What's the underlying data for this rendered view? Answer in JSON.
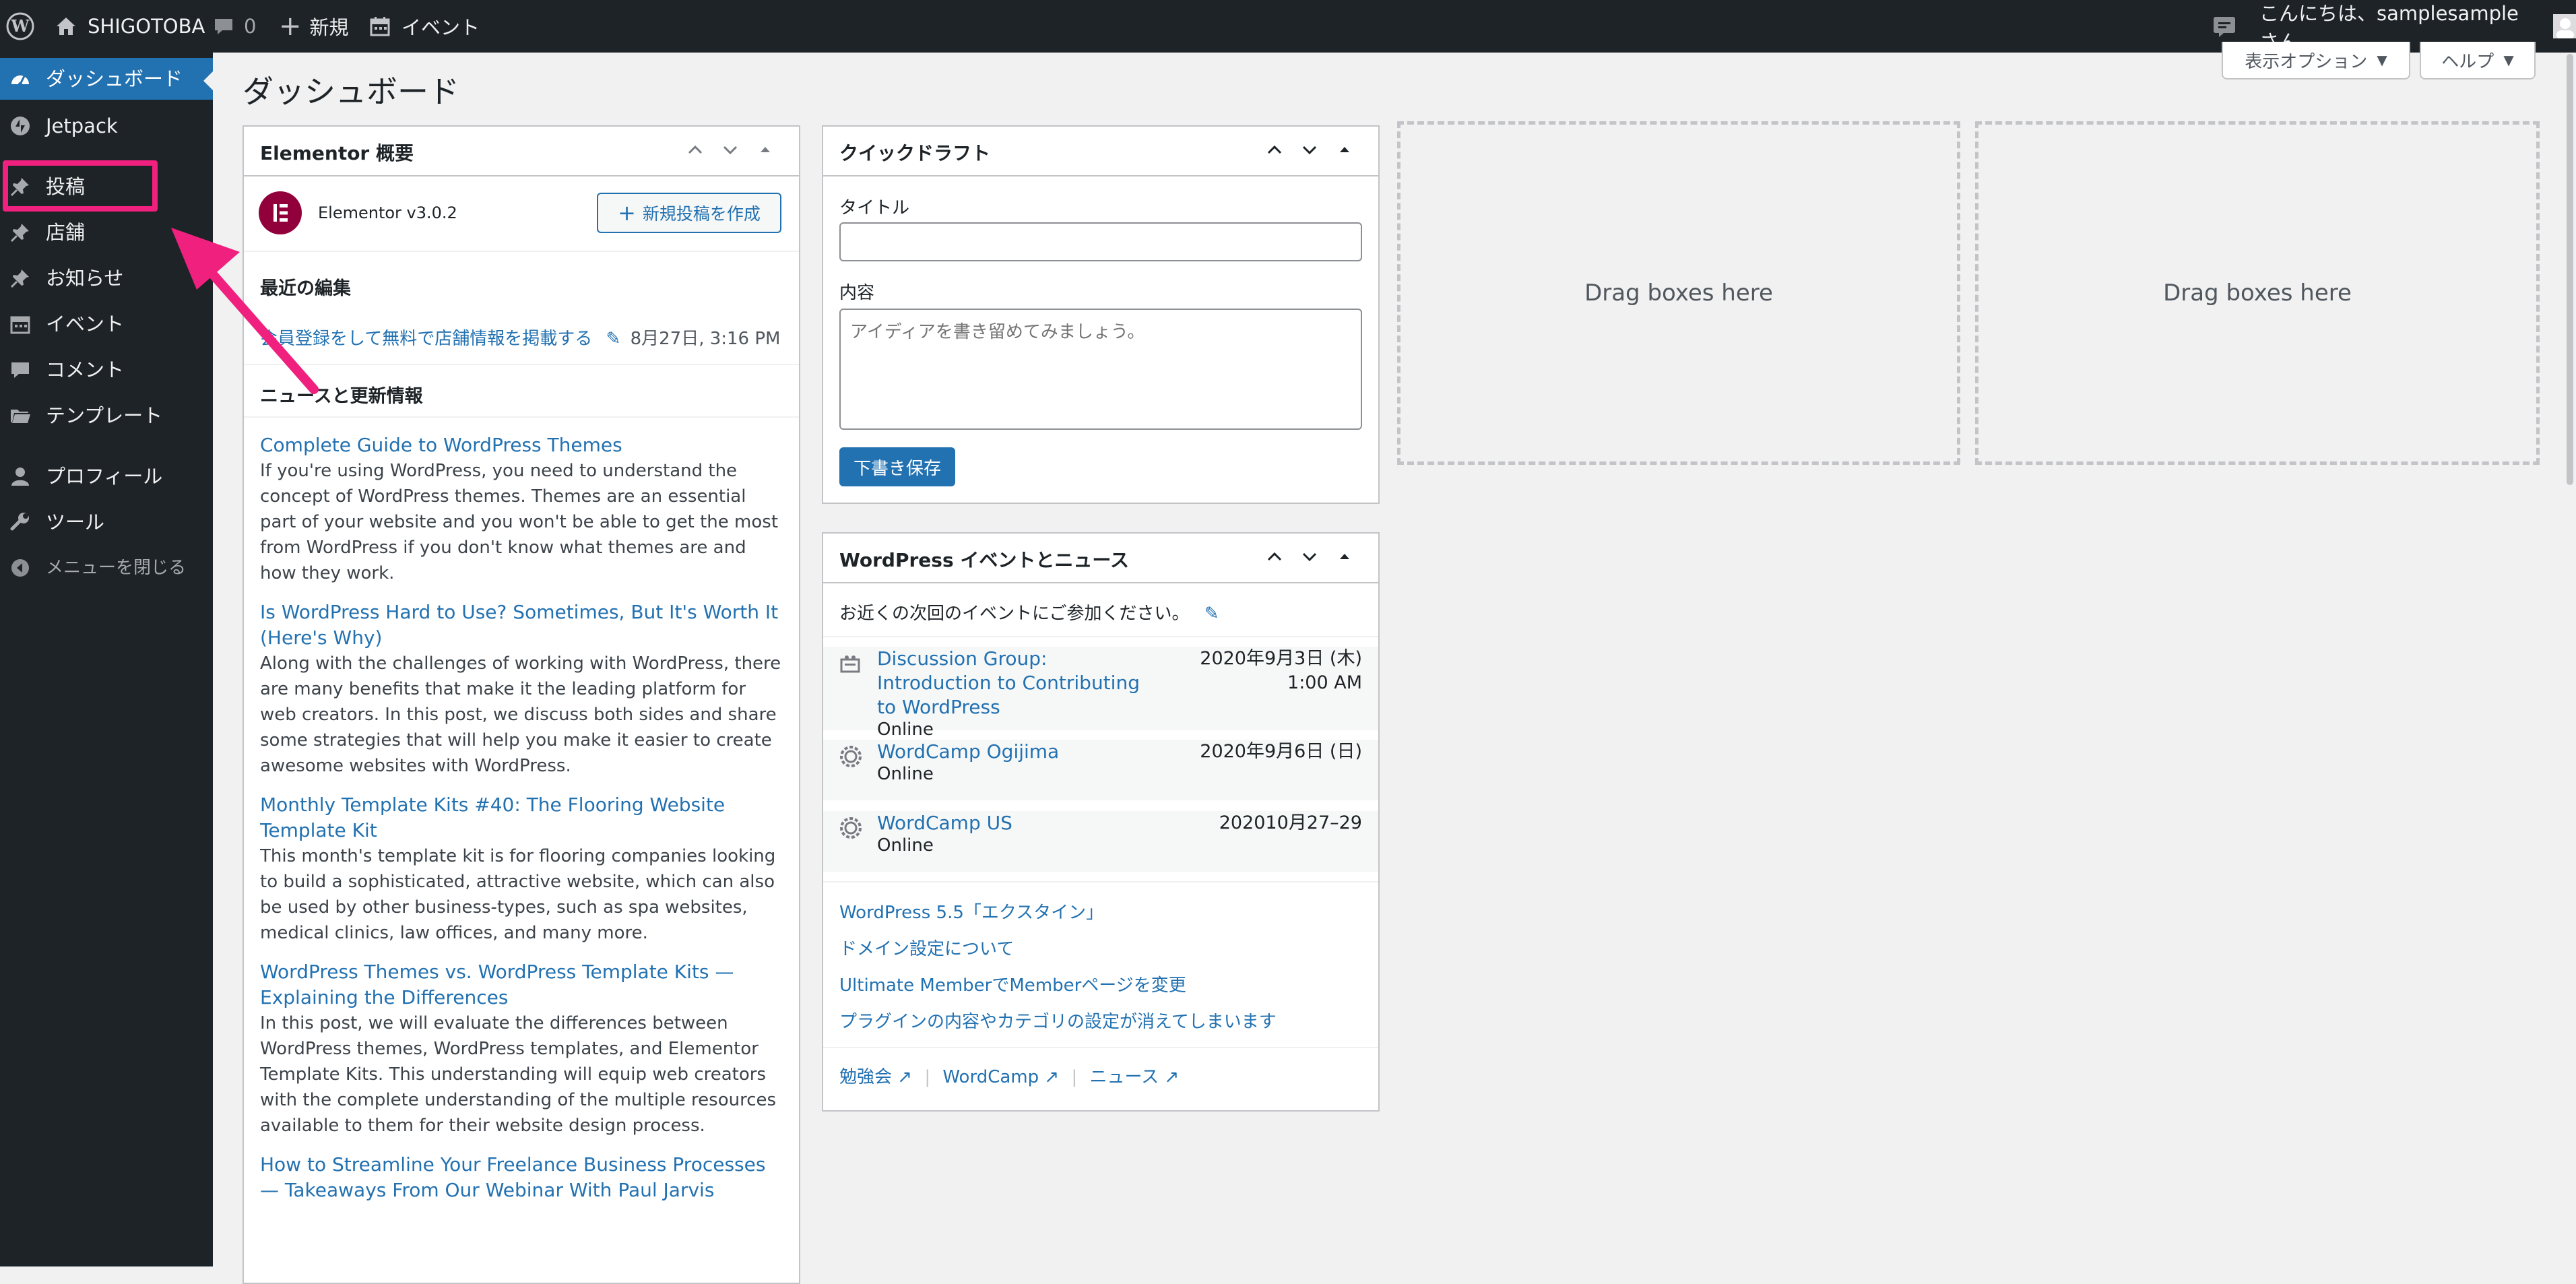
{
  "adminbar": {
    "site_name": "SHIGOTOBA",
    "comments_count": "0",
    "new_label": "新規",
    "event_label": "イベント",
    "greeting": "こんにちは、samplesample さん"
  },
  "sidebar": {
    "items": [
      {
        "label": "ダッシュボード",
        "icon": "dashboard-icon"
      },
      {
        "label": "Jetpack",
        "icon": "jetpack-icon"
      },
      {
        "label": "投稿",
        "icon": "pin-icon"
      },
      {
        "label": "店舗",
        "icon": "pin-icon"
      },
      {
        "label": "お知らせ",
        "icon": "pin-icon"
      },
      {
        "label": "イベント",
        "icon": "calendar-icon"
      },
      {
        "label": "コメント",
        "icon": "comment-icon"
      },
      {
        "label": "テンプレート",
        "icon": "folder-icon"
      },
      {
        "label": "プロフィール",
        "icon": "user-icon"
      },
      {
        "label": "ツール",
        "icon": "wrench-icon"
      },
      {
        "label": "メニューを閉じる",
        "icon": "collapse-icon"
      }
    ]
  },
  "header": {
    "title": "ダッシュボード",
    "screen_options": "表示オプション",
    "help": "ヘルプ"
  },
  "elementor": {
    "title": "Elementor 概要",
    "version": "Elementor v3.0.2",
    "create_button": "新規投稿を作成",
    "recent_heading": "最近の編集",
    "recent_item": "会員登録をして無料で店舗情報を掲載する",
    "recent_date": "8月27日, 3:16 PM",
    "news_heading": "ニュースと更新情報",
    "news": [
      {
        "title": "Complete Guide to WordPress Themes",
        "excerpt": "If you're using WordPress, you need to understand the concept of WordPress themes. Themes are an essential part of your website and you won't be able to get the most from WordPress if you don't know what themes are and how they work."
      },
      {
        "title": "Is WordPress Hard to Use? Sometimes, But It's Worth It (Here's Why)",
        "excerpt": "Along with the challenges of working with WordPress, there are many benefits that make it the leading platform for web creators. In this post, we discuss both sides and share some strategies that will help you make it easier to create awesome websites with WordPress."
      },
      {
        "title": "Monthly Template Kits #40: The Flooring Website Template Kit",
        "excerpt": "This month's template kit is for flooring companies looking to build a sophisticated, attractive website, which can also be used by other business-types, such as spa websites, medical clinics, law offices, and many more."
      },
      {
        "title": "WordPress Themes vs. WordPress Template Kits — Explaining the Differences",
        "excerpt": "In this post, we will evaluate the differences between WordPress themes, WordPress templates, and Elementor Template Kits. This understanding will equip web creators with the complete understanding of the multiple resources available to them for their website design process."
      },
      {
        "title": "How to Streamline Your Freelance Business Processes — Takeaways From Our Webinar With Paul Jarvis",
        "excerpt": ""
      }
    ]
  },
  "quickdraft": {
    "title": "クイックドラフト",
    "title_label": "タイトル",
    "title_value": "",
    "content_label": "内容",
    "content_placeholder": "アイディアを書き留めてみましょう。",
    "save_button": "下書き保存"
  },
  "events": {
    "title": "WordPress イベントとニュース",
    "intro": "お近くの次回のイベントにご参加ください。",
    "items": [
      {
        "title": "Discussion Group: Introduction to Contributing to WordPress",
        "location": "Online",
        "date": "2020年9月3日 (木)",
        "time": "1:00 AM"
      },
      {
        "title": "WordCamp Ogijima",
        "location": "Online",
        "date": "2020年9月6日 (日)",
        "time": ""
      },
      {
        "title": "WordCamp US",
        "location": "Online",
        "date": "202010月27–29",
        "time": ""
      }
    ],
    "news": [
      "WordPress 5.5「エクスタイン」",
      "ドメイン設定について",
      "Ultimate MemberでMemberページを変更",
      "プラグインの内容やカテゴリの設定が消えてしまいます"
    ],
    "footer_links": [
      "勉強会",
      "WordCamp",
      "ニュース"
    ]
  },
  "dropzones": {
    "label": "Drag boxes here"
  },
  "colors": {
    "adminbar_bg": "#1d2327",
    "accent": "#2271b1",
    "highlight": "#f0207f"
  }
}
